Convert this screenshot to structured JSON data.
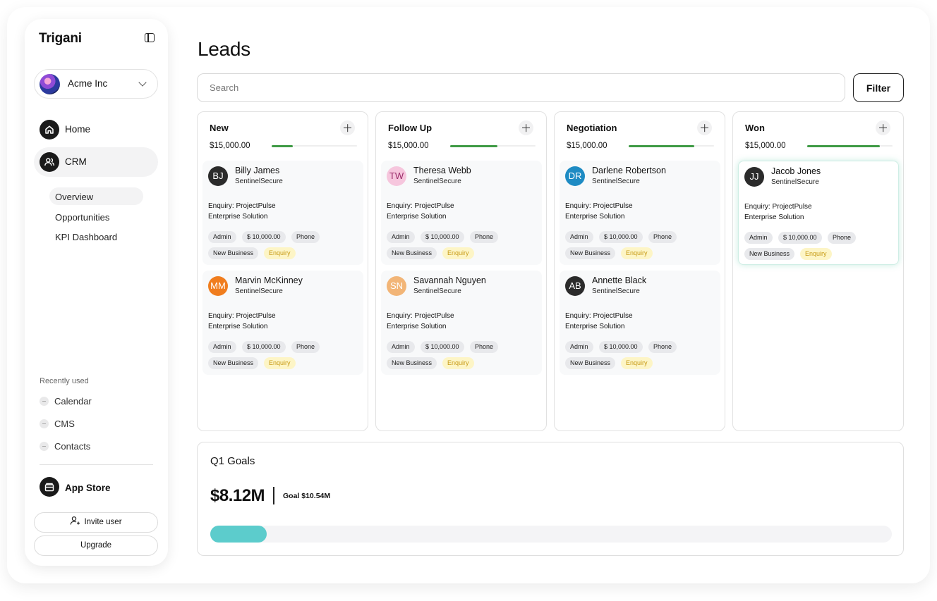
{
  "sidebar": {
    "brand": "Trigani",
    "org": {
      "name": "Acme Inc"
    },
    "nav": [
      {
        "label": "Home",
        "icon": "home-icon",
        "active": false
      },
      {
        "label": "CRM",
        "icon": "users-icon",
        "active": true
      }
    ],
    "subnav": [
      {
        "label": "Overview",
        "active": true
      },
      {
        "label": "Opportunities",
        "active": false
      },
      {
        "label": "KPI Dashboard",
        "active": false
      }
    ],
    "recent_title": "Recently used",
    "recent": [
      {
        "label": "Calendar"
      },
      {
        "label": "CMS"
      },
      {
        "label": "Contacts"
      }
    ],
    "app_store": "App Store",
    "invite_label": "Invite user",
    "upgrade_label": "Upgrade"
  },
  "main": {
    "title": "Leads",
    "search_placeholder": "Search",
    "filter_label": "Filter",
    "columns": [
      {
        "title": "New",
        "amount": "$15,000.00",
        "progress": 0.25,
        "cards": [
          {
            "initials": "BJ",
            "avatar_color": "#2b2b2b",
            "name": "Billy James",
            "company": "SentinelSecure",
            "enquiry": "Enquiry: ProjectPulse",
            "solution": "Enterprise Solution",
            "tags": [
              "Admin",
              "$ 10,000.00",
              "Phone",
              "New Business",
              "Enquiry"
            ]
          },
          {
            "initials": "MM",
            "avatar_color": "#f07d1e",
            "name": "Marvin McKinney",
            "company": "SentinelSecure",
            "enquiry": "Enquiry: ProjectPulse",
            "solution": "Enterprise Solution",
            "tags": [
              "Admin",
              "$ 10,000.00",
              "Phone",
              "New Business",
              "Enquiry"
            ]
          }
        ]
      },
      {
        "title": "Follow Up",
        "amount": "$15,000.00",
        "progress": 0.55,
        "cards": [
          {
            "initials": "TW",
            "avatar_color": "#f6c6dd",
            "name": "Theresa Webb",
            "company": "SentinelSecure",
            "enquiry": "Enquiry: ProjectPulse",
            "solution": "Enterprise Solution",
            "tags": [
              "Admin",
              "$ 10,000.00",
              "Phone",
              "New Business",
              "Enquiry"
            ]
          },
          {
            "initials": "SN",
            "avatar_color": "#f2b577",
            "name": "Savannah Nguyen",
            "company": "SentinelSecure",
            "enquiry": "Enquiry: ProjectPulse",
            "solution": "Enterprise Solution",
            "tags": [
              "Admin",
              "$ 10,000.00",
              "Phone",
              "New Business",
              "Enquiry"
            ]
          }
        ]
      },
      {
        "title": "Negotiation",
        "amount": "$15,000.00",
        "progress": 0.77,
        "cards": [
          {
            "initials": "DR",
            "avatar_color": "#1e8bc3",
            "name": "Darlene Robertson",
            "company": "SentinelSecure",
            "enquiry": "Enquiry: ProjectPulse",
            "solution": "Enterprise Solution",
            "tags": [
              "Admin",
              "$ 10,000.00",
              "Phone",
              "New Business",
              "Enquiry"
            ]
          },
          {
            "initials": "AB",
            "avatar_color": "#2b2b2b",
            "name": "Annette Black",
            "company": "SentinelSecure",
            "enquiry": "Enquiry: ProjectPulse",
            "solution": "Enterprise Solution",
            "tags": [
              "Admin",
              "$ 10,000.00",
              "Phone",
              "New Business",
              "Enquiry"
            ]
          }
        ]
      },
      {
        "title": "Won",
        "amount": "$15,000.00",
        "progress": 0.85,
        "cards": [
          {
            "initials": "JJ",
            "avatar_color": "#2b2b2b",
            "name": "Jacob Jones",
            "company": "SentinelSecure",
            "enquiry": "Enquiry: ProjectPulse",
            "solution": "Enterprise Solution",
            "tags": [
              "Admin",
              "$ 10,000.00",
              "Phone",
              "New Business",
              "Enquiry"
            ],
            "highlighted": true
          }
        ]
      }
    ],
    "goals": {
      "title": "Q1 Goals",
      "value": "$8.12M",
      "goal_label": "Goal $10.54M",
      "progress": 0.083,
      "bar_color": "#5ccccc"
    }
  }
}
